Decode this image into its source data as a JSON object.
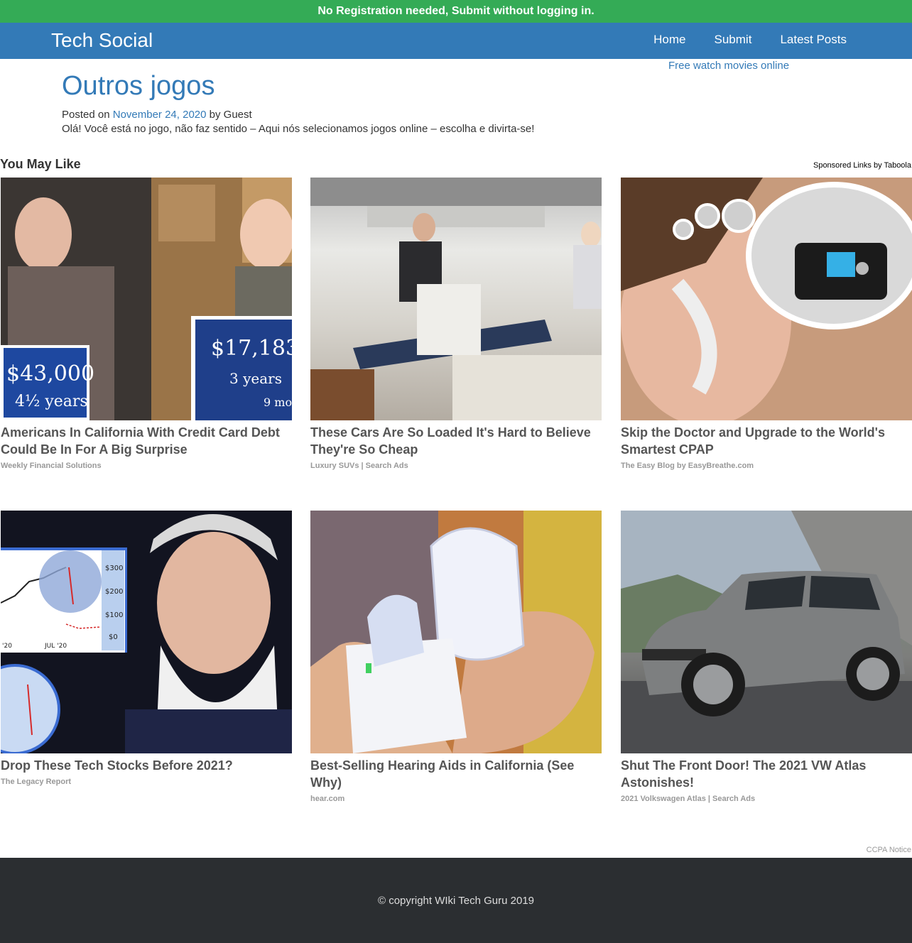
{
  "banner": {
    "text": "No Registration needed, Submit without logging in."
  },
  "navbar": {
    "brand": "Tech Social",
    "links": [
      "Home",
      "Submit",
      "Latest Posts"
    ]
  },
  "sidebar": {
    "link": "Free watch movies online"
  },
  "post": {
    "title": "Outros jogos",
    "posted_on_label": "Posted on",
    "date": "November 24, 2020",
    "by_label": "by",
    "author": "Guest",
    "body": "Olá! Você está no jogo, não faz sentido – Aqui nós selecionamos jogos online – escolha e divirta-se!"
  },
  "recommendations": {
    "heading": "You May Like",
    "sponsored": "Sponsored Links by Taboola",
    "cards": [
      {
        "title": "Americans In California With Credit Card Debt Could Be In For A Big Surprise",
        "source": "Weekly Financial Solutions"
      },
      {
        "title": "These Cars Are So Loaded It's Hard to Believe They're So Cheap",
        "source": "Luxury SUVs | Search Ads"
      },
      {
        "title": "Skip the Doctor and Upgrade to the World's Smartest CPAP",
        "source": "The Easy Blog by EasyBreathe.com"
      },
      {
        "title": "Drop These Tech Stocks Before 2021?",
        "source": "The Legacy Report"
      },
      {
        "title": "Best-Selling Hearing Aids in California (See Why)",
        "source": "hear.com"
      },
      {
        "title": "Shut The Front Door! The 2021 VW Atlas Astonishes!",
        "source": "2021 Volkswagen Atlas | Search Ads"
      }
    ],
    "image_texts": {
      "card1_left_board": [
        "$43,000",
        "4½ years"
      ],
      "card1_right_board": [
        "$17,183",
        "3 years",
        "9 mo"
      ],
      "card4_chart_ticks": [
        "$300",
        "$200",
        "$100",
        "$0",
        "'20",
        "JUL '20"
      ]
    }
  },
  "ccpa": "CCPA Notice",
  "footer": {
    "copyright": "© copyright WIki Tech Guru 2019"
  }
}
